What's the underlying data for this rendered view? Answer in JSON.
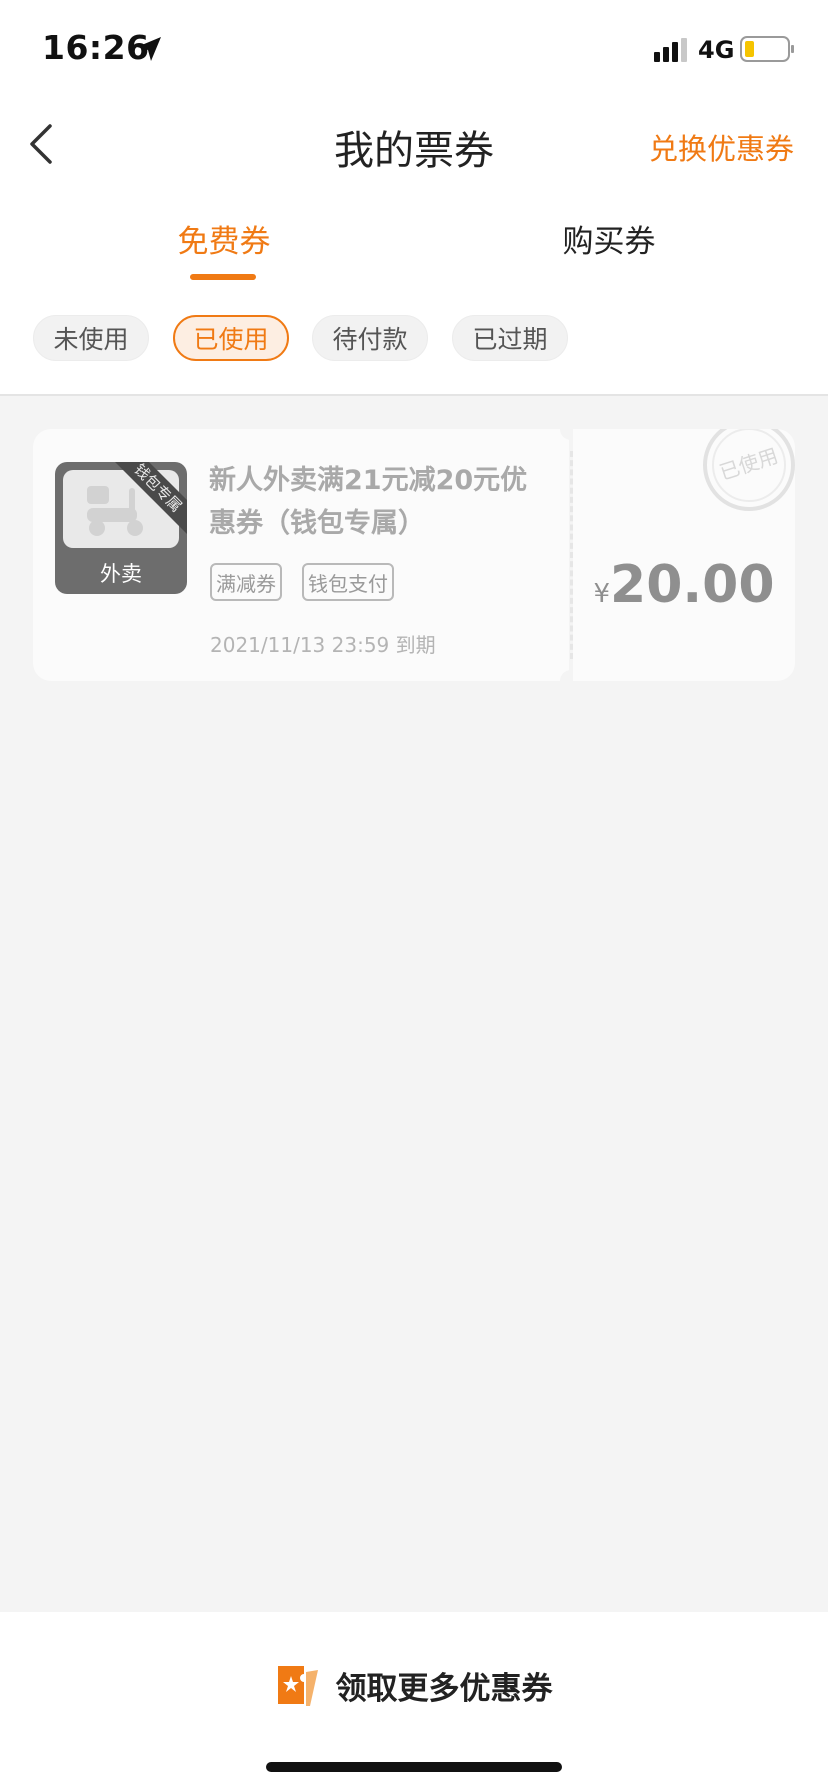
{
  "status_bar": {
    "time": "16:26",
    "network": "4G",
    "battery_color": "#f5c400"
  },
  "header": {
    "title": "我的票券",
    "back_icon": "chevron-left-icon",
    "redeem_label": "兑换优惠券"
  },
  "tabs": [
    {
      "label": "免费券",
      "active": true
    },
    {
      "label": "购买券",
      "active": false
    }
  ],
  "filters": [
    {
      "label": "未使用",
      "active": false
    },
    {
      "label": "已使用",
      "active": true
    },
    {
      "label": "待付款",
      "active": false
    },
    {
      "label": "已过期",
      "active": false
    }
  ],
  "coupon": {
    "thumbnail_label": "外卖",
    "ribbon_label": "钱包专属",
    "title": "新人外卖满21元减20元优惠券（钱包专属）",
    "tags": [
      "满减券",
      "钱包支付"
    ],
    "expiry": "2021/11/13 23:59 到期",
    "currency": "¥",
    "amount": "20.00",
    "stamp_label": "已使用"
  },
  "bottom": {
    "cta_label": "领取更多优惠券",
    "cta_icon": "ticket-icon"
  },
  "colors": {
    "accent": "#f07a14",
    "background": "#f4f4f4"
  }
}
